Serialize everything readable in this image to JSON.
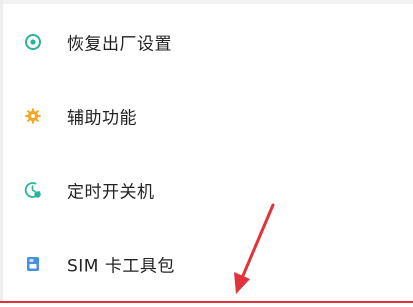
{
  "menu": {
    "items": [
      {
        "label": "恢复出厂设置",
        "icon": "factory-reset-icon"
      },
      {
        "label": "辅助功能",
        "icon": "accessibility-gear-icon"
      },
      {
        "label": "定时开关机",
        "icon": "scheduled-power-icon"
      },
      {
        "label": "SIM 卡工具包",
        "icon": "sim-card-icon"
      }
    ]
  },
  "colors": {
    "icon_teal": "#2bb39a",
    "icon_orange": "#f5a623",
    "icon_blue": "#4a90e2",
    "annotation_red": "#e3333a",
    "text": "#222222"
  },
  "annotation": {
    "icon": "red-arrow-annotation"
  }
}
